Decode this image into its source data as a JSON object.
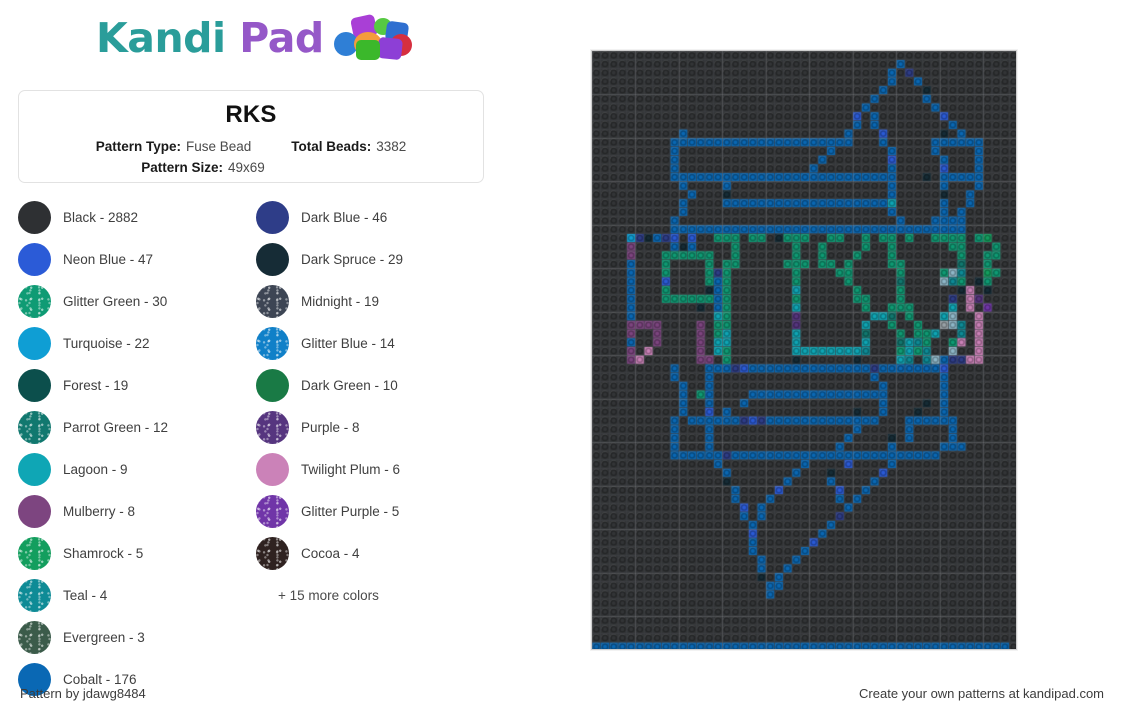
{
  "brand": {
    "name_part1": "Kandi",
    "name_part2": " Pad",
    "color_teal": "#2a9d9a",
    "color_purple": "#9558c8"
  },
  "info_card": {
    "title": "RKS",
    "pattern_type_label": "Pattern Type:",
    "pattern_type_value": "Fuse Bead",
    "total_beads_label": "Total Beads:",
    "total_beads_value": "3382",
    "pattern_size_label": "Pattern Size:",
    "pattern_size_value": "49x69"
  },
  "legend": {
    "more_colors": "+ 15 more colors",
    "items": [
      {
        "label": "Black - 2882",
        "name": "Black",
        "count": 2882,
        "hex": "#2e3033",
        "glitter": false
      },
      {
        "label": "Neon Blue - 47",
        "name": "Neon Blue",
        "count": 47,
        "hex": "#2b5bd7",
        "glitter": false
      },
      {
        "label": "Glitter Green - 30",
        "name": "Glitter Green",
        "count": 30,
        "hex": "#0f9b74",
        "glitter": true
      },
      {
        "label": "Turquoise - 22",
        "name": "Turquoise",
        "count": 22,
        "hex": "#0f9ed4",
        "glitter": false
      },
      {
        "label": "Forest - 19",
        "name": "Forest",
        "count": 19,
        "hex": "#0c4f4c",
        "glitter": false
      },
      {
        "label": "Parrot Green - 12",
        "name": "Parrot Green",
        "count": 12,
        "hex": "#11786f",
        "glitter": true
      },
      {
        "label": "Lagoon - 9",
        "name": "Lagoon",
        "count": 9,
        "hex": "#0fa6b5",
        "glitter": false
      },
      {
        "label": "Mulberry - 8",
        "name": "Mulberry",
        "count": 8,
        "hex": "#7d4580",
        "glitter": false
      },
      {
        "label": "Shamrock - 5",
        "name": "Shamrock",
        "count": 5,
        "hex": "#139e5e",
        "glitter": true
      },
      {
        "label": "Teal - 4",
        "name": "Teal",
        "count": 4,
        "hex": "#0e8b96",
        "glitter": true
      },
      {
        "label": "Evergreen - 3",
        "name": "Evergreen",
        "count": 3,
        "hex": "#3b5b4a",
        "glitter": true
      },
      {
        "label": "Cobalt - 176",
        "name": "Cobalt",
        "count": 176,
        "hex": "#0a68b4",
        "glitter": false
      },
      {
        "label": "Dark Blue - 46",
        "name": "Dark Blue",
        "count": 46,
        "hex": "#2e3d88",
        "glitter": false
      },
      {
        "label": "Dark Spruce - 29",
        "name": "Dark Spruce",
        "count": 29,
        "hex": "#162c36",
        "glitter": false
      },
      {
        "label": "Midnight - 19",
        "name": "Midnight",
        "count": 19,
        "hex": "#3d4554",
        "glitter": true
      },
      {
        "label": "Glitter Blue - 14",
        "name": "Glitter Blue",
        "count": 14,
        "hex": "#1080c8",
        "glitter": true
      },
      {
        "label": "Dark Green - 10",
        "name": "Dark Green",
        "count": 10,
        "hex": "#197a45",
        "glitter": false
      },
      {
        "label": "Purple - 8",
        "name": "Purple",
        "count": 8,
        "hex": "#56357f",
        "glitter": true
      },
      {
        "label": "Twilight Plum - 6",
        "name": "Twilight Plum",
        "count": 6,
        "hex": "#cb82b8",
        "glitter": false
      },
      {
        "label": "Glitter Purple - 5",
        "name": "Glitter Purple",
        "count": 5,
        "hex": "#7035a8",
        "glitter": true
      },
      {
        "label": "Cocoa - 4",
        "name": "Cocoa",
        "count": 4,
        "hex": "#2f2220",
        "glitter": true
      }
    ]
  },
  "pattern": {
    "cols": 49,
    "rows": 69,
    "background_hex": "#3e4044",
    "bead_base_hex": "#333537",
    "palette": {
      "K": "#2e3033",
      "C": "#0a68b4",
      "N": "#2b5bd7",
      "B": "#2e3d88",
      "G": "#0f9b74",
      "S": "#162c36",
      "T": "#0f9ed4",
      "M": "#3d4554",
      "F": "#0c4f4c",
      "L": "#1080c8",
      "P": "#11786f",
      "D": "#197a45",
      "A": "#0fa6b5",
      "U": "#56357f",
      "Y": "#7d4580",
      "W": "#cb82b8",
      "R": "#139e5e",
      "E": "#7035a8",
      "Q": "#0e8b96",
      "V": "#3b5b4a",
      "X": "#8fb8c9",
      "Z": "#9aa3a8"
    },
    "rowmap": [
      ".................................................",
      "...................................C.............",
      "..................................C.B............",
      "..................................C..C...........",
      ".................................C....S..........",
      "................................C.....C..........",
      "...............................C.......C.........",
      "..............................N.C.......N........",
      "..............................C.C........C.......",
      "..........C..................C...N......S.C......",
      ".........CCCCCCCCCCCCCCCCCCCCC...C.....CCCCCC....",
      ".........C.................C......C....C....C....",
      ".........C................C.......N.....C...C....",
      ".........C...............C........C.....N...C....",
      ".........CCCCCCCCCCCCCCCCCCCCCCCCCC...S.CCCCC....",
      "..........C....C..................C.....C...C....",
      "...........C...S..................C.....S..C.....",
      "..........C....CCCCCCCCCCCCCCCCCCCA.....C..C.....",
      "..........C.......................C.....C.C......",
      ".........C.........................C...CCCC......",
      ".........CCCCCCCCCCCCCCCCCCCCCCCCCCCCCCCCCC......",
      "....TBSCBN.N..GGG.GG.SGGG..GG..G.GG.G..GGGG.GR...",
      "....Y....CSC....G......G..G....G..G......GG...G..",
      "....Y...GGGGGG..G......G..G...G...G.......G..GG..",
      "....C...G....G.GG.....GGG.GG.G....GG......P..G...",
      "....C...G....GBG.......G....GG.....G....GXQ..RG..",
      "....C...N....GCG.......G.....G.....P....XQG.SG...",
      "....C...G....SCG.......A......G....G......SW.S...",
      "....C...GGGGGGCG.......G......GG...G.....B.WU....",
      "....C.......S.CG.......A.......G..GGG....A.W.E...",
      "....C.........AG.......U........AAP.G...AX..W....",
      "....YYYY....Y.GG.......U.......A..G..G..ZXQ.W....",
      "....Y..Y....Y.GA.......A.......P...G.GGA..Q.W....",
      "....C..Y....Y.AA.......A.......A...PAQG..GW.W....",
      "....Y.W.....Y.AG.......AAAAAAAAQ...GAGQ..X..W....",
      "....YW......YY.G.......S......S....AQ.QXCBBWW....",
      ".........C...CCCBNCCCCCCCCCCCCCCBCCCCCCCN........",
      ".........C...C..................C.......C........",
      "..........C..C...................C......C........",
      "..........C.GC....CCCCCCCCCCCCCCCC......C........",
      "..........C..C...C...............C....S.C........",
      "..........C..N.C..............S..C...S..C........",
      ".........C.CCCCCCBNBCCCCCCCCCCCCC...CCCCCC.......",
      ".........C...C................C.....C....C.......",
      ".........C...C...............C....S.C....C.......",
      ".........C...C..............C.....C.....CCC......",
      ".........CCCCCCBCCCCCCCCCCCCCCCCCCCCCCCC........",
      "..............C.........C....N....C..............",
      "...............C.......C...S.....N...............",
      "...............S......C....C....C................",
      "................C....N......N..C.................",
      "................C...C.......C.C..................",
      ".................N.C.........C...................",
      ".................C.C........B....................",
      "..................C........C.....................",
      "..................N.......C......................",
      "..................C......N.......................",
      "..................C.....C........................",
      "...................C...C.........................",
      "...................C..C..........................",
      "...................S.C...........................",
      "....................CC...........................",
      "....................C............................",
      ".................................................",
      ".................................................",
      ".................................................",
      ".................................................",
      ".................................................",
      "CCCCCCCCCCCCCCCCCCCCCCCCCCCCCCCCCCCCCCCCCCCCCCCC"
    ]
  },
  "footer": {
    "left": "Pattern by jdawg8484",
    "right": "Create your own patterns at kandipad.com"
  }
}
